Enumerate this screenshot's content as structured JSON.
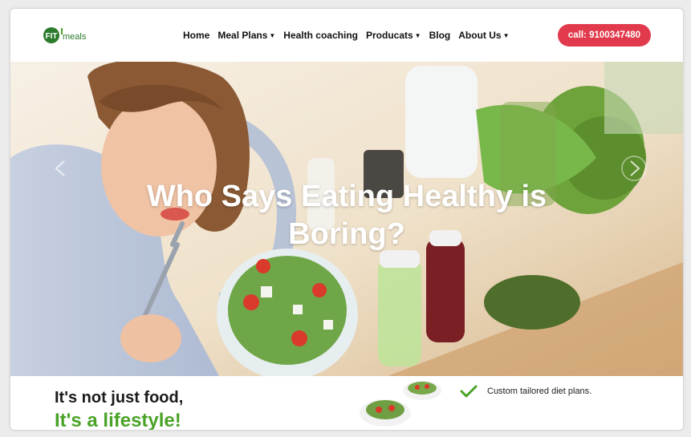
{
  "header": {
    "logo_text": "FITmeals",
    "nav": [
      {
        "label": "Home",
        "dropdown": false
      },
      {
        "label": "Meal Plans",
        "dropdown": true
      },
      {
        "label": "Health coaching",
        "dropdown": false
      },
      {
        "label": "Producats",
        "dropdown": true
      },
      {
        "label": "Blog",
        "dropdown": false
      },
      {
        "label": "About Us",
        "dropdown": true
      }
    ],
    "call_button": "call: 9100347480"
  },
  "hero": {
    "title_line1": "Who Says Eating Healthy is",
    "title_line2": "Boring?"
  },
  "bottom": {
    "tagline1": "It's not just food,",
    "tagline2": "It's a lifestyle!",
    "feature1": "Custom tailored diet plans."
  },
  "colors": {
    "accent": "#e23a4d",
    "green": "#4aa327"
  },
  "icons": {
    "prev": "chevron-left-icon",
    "next": "chevron-right-icon",
    "check": "check-icon"
  }
}
